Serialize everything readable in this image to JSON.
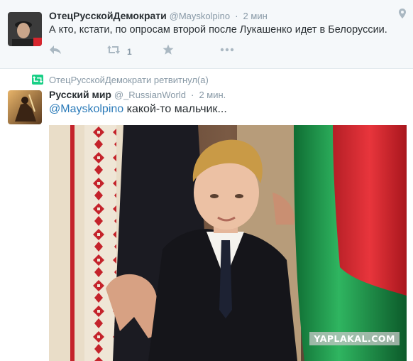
{
  "tweet1": {
    "name": "ОтецРусскойДемократи",
    "handle": "@Mayskolpino",
    "separator": "·",
    "time": "2 мин",
    "text": "А кто, кстати, по опросам второй после Лукашенко идет в Белоруссии.",
    "retweet_count": "1",
    "icons": [
      "reply-icon",
      "retweet-icon",
      "favorite-icon",
      "more-icon",
      "location-pin-icon"
    ]
  },
  "retweet_notice": {
    "text": "ОтецРусскойДемократи ретвитнул(а)"
  },
  "tweet2": {
    "name": "Русский мир",
    "handle": "@_RussianWorld",
    "separator": "·",
    "time": "2 мин.",
    "mention": "@Mayskolpino",
    "text": " какой-то мальчик..."
  },
  "photo": {
    "watermark": "YAPLAKAL.COM"
  },
  "colors": {
    "flag_red": "#d7262e",
    "flag_green": "#1e9a4a",
    "link": "#2b7bb9",
    "retweet_green": "#19cf86"
  }
}
